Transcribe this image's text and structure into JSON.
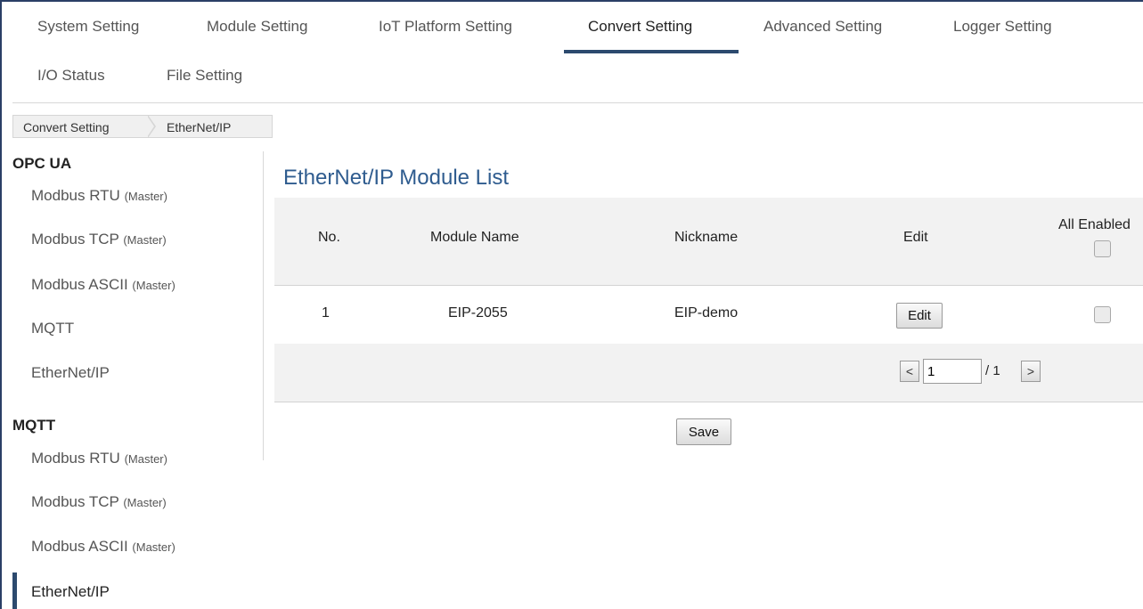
{
  "top_tabs": [
    {
      "label": "System Setting",
      "active": false
    },
    {
      "label": "Module Setting",
      "active": false
    },
    {
      "label": "IoT Platform Setting",
      "active": false
    },
    {
      "label": "Convert Setting",
      "active": true
    },
    {
      "label": "Advanced Setting",
      "active": false
    },
    {
      "label": "Logger Setting",
      "active": false
    },
    {
      "label": "I/O Status",
      "active": false
    },
    {
      "label": "File Setting",
      "active": false
    }
  ],
  "breadcrumb": [
    "Convert Setting",
    "EtherNet/IP"
  ],
  "sidebar": {
    "groups": [
      {
        "heading": "OPC UA",
        "items": [
          {
            "label": "Modbus RTU",
            "tag": "(Master)"
          },
          {
            "label": "Modbus TCP",
            "tag": "(Master)"
          },
          {
            "label": "Modbus ASCII",
            "tag": "(Master)"
          },
          {
            "label": "MQTT",
            "tag": ""
          },
          {
            "label": "EtherNet/IP",
            "tag": ""
          }
        ]
      },
      {
        "heading": "MQTT",
        "items": [
          {
            "label": "Modbus RTU",
            "tag": "(Master)"
          },
          {
            "label": "Modbus TCP",
            "tag": "(Master)"
          },
          {
            "label": "Modbus ASCII",
            "tag": "(Master)"
          },
          {
            "label": "EtherNet/IP",
            "tag": "",
            "active": true
          }
        ]
      }
    ]
  },
  "main": {
    "title": "EtherNet/IP Module List",
    "columns": {
      "no": "No.",
      "module_name": "Module Name",
      "nickname": "Nickname",
      "edit": "Edit",
      "all_enabled": "All Enabled"
    },
    "rows": [
      {
        "no": "1",
        "module_name": "EIP-2055",
        "nickname": "EIP-demo",
        "edit_label": "Edit",
        "enabled": false
      }
    ],
    "all_enabled_checked": false,
    "pager": {
      "prev": "<",
      "next": ">",
      "page": "1",
      "total": "/ 1"
    },
    "save_label": "Save"
  },
  "colors": {
    "accent": "#2c4a6e",
    "title": "#2f5c8f",
    "table_header_bg": "#f2f2f2"
  }
}
